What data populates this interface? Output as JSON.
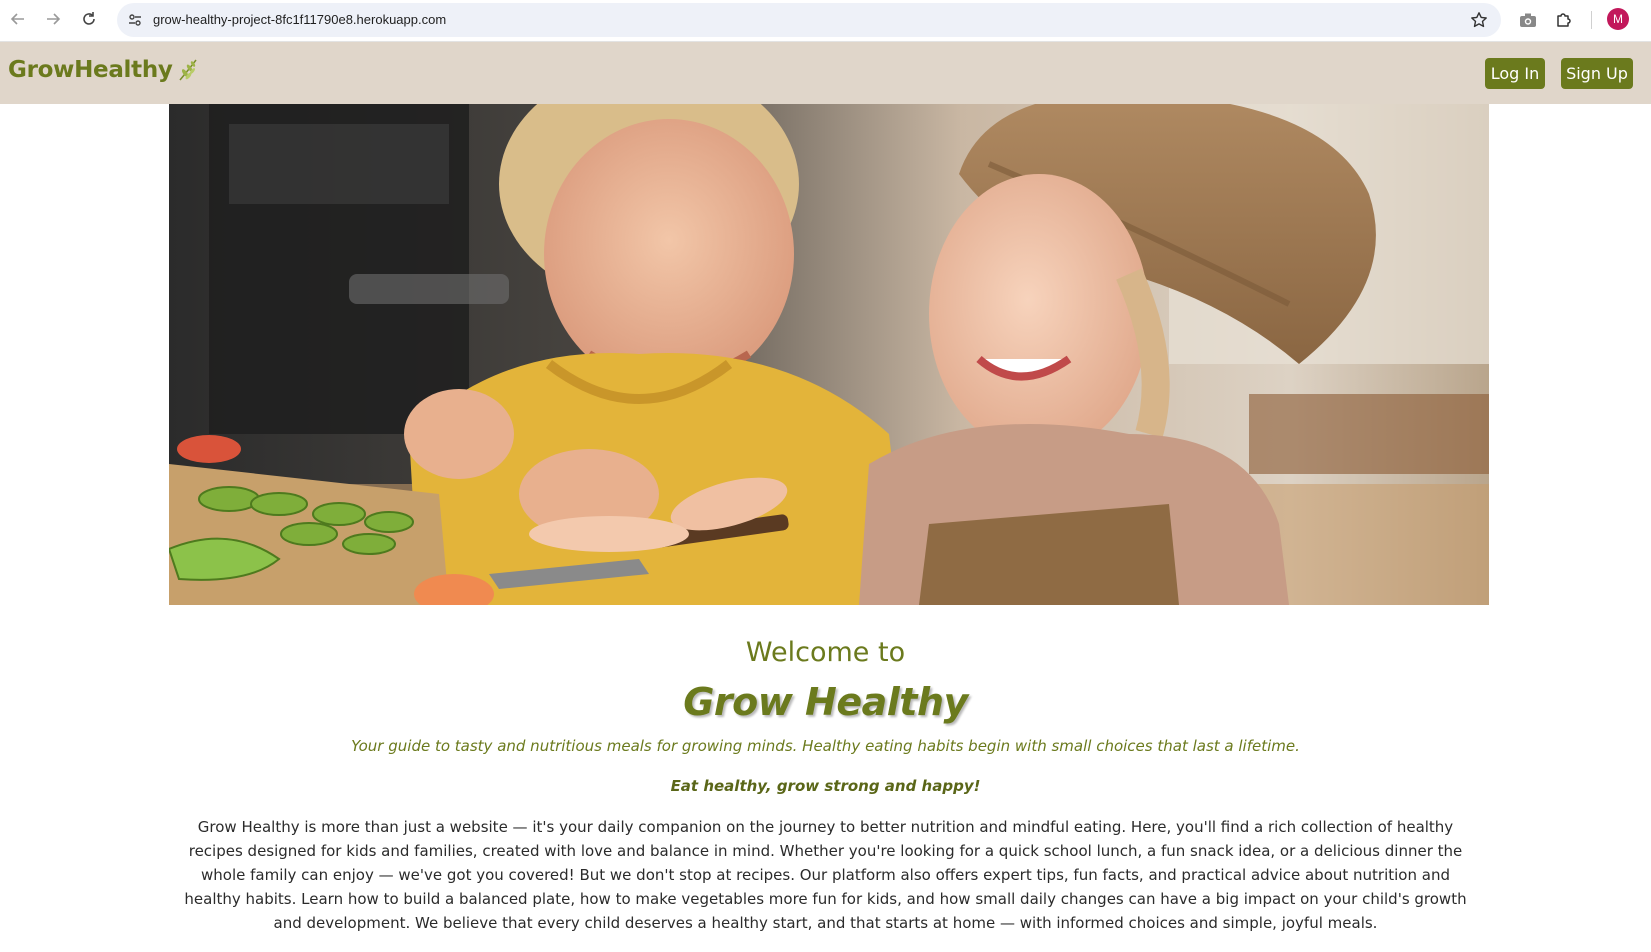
{
  "browser": {
    "url": "grow-healthy-project-8fc1f11790e8.herokuapp.com",
    "profile_initial": "M"
  },
  "header": {
    "logo_text": "GrowHealthy",
    "logo_icon": "leaf-sprig-icon",
    "login_label": "Log In",
    "signup_label": "Sign Up"
  },
  "hero": {
    "image": "kids-cooking-photo"
  },
  "content": {
    "welcome": "Welcome to",
    "title": "Grow Healthy",
    "tagline": "Your guide to tasty and nutritious meals for growing minds. Healthy eating habits begin with small choices that last a lifetime.",
    "motto": "Eat healthy, grow strong and happy!",
    "intro": "Grow Healthy is more than just a website — it's your daily companion on the journey to better nutrition and mindful eating. Here, you'll find a rich collection of healthy recipes designed for kids and families, created with love and balance in mind. Whether you're looking for a quick school lunch, a fun snack idea, or a delicious dinner the whole family can enjoy — we've got you covered! But we don't stop at recipes. Our platform also offers expert tips, fun facts, and practical advice about nutrition and healthy habits. Learn how to build a balanced plate, how to make vegetables more fun for kids, and how small daily changes can have a big impact on your child's growth and development. We believe that every child deserves a healthy start, and that starts at home — with informed choices and simple, joyful meals."
  },
  "colors": {
    "brand_green": "#6b7a1d",
    "header_bg": "#e0d6ca"
  }
}
